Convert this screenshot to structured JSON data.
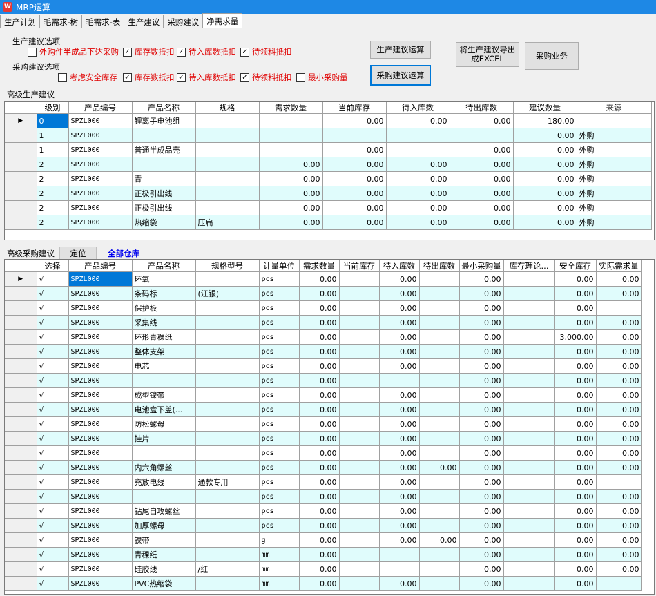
{
  "window": {
    "title": "MRP运算",
    "icon": "app-logo-icon"
  },
  "tabs": [
    "生产计划",
    "毛需求-树",
    "毛需求-表",
    "生产建议",
    "采购建议",
    "净需求量"
  ],
  "active_tab": "净需求量",
  "prod_options": {
    "label": "生产建议选项",
    "items": [
      {
        "label": "外购件半成品下达采购",
        "checked": false
      },
      {
        "label": "库存数抵扣",
        "checked": true
      },
      {
        "label": "待入库数抵扣",
        "checked": true
      },
      {
        "label": "待领料抵扣",
        "checked": true
      }
    ]
  },
  "purch_options": {
    "label": "采购建议选项",
    "items": [
      {
        "label": "考虑安全库存",
        "checked": false
      },
      {
        "label": "库存数抵扣",
        "checked": true
      },
      {
        "label": "待入库数抵扣",
        "checked": true
      },
      {
        "label": "待领料抵扣",
        "checked": true
      },
      {
        "label": "最小采购量",
        "checked": false
      }
    ]
  },
  "buttons": {
    "prod_calc": "生产建议运算",
    "purch_calc": "采购建议运算",
    "export": "将生产建议导出成EXCEL",
    "purch_business": "采购业务"
  },
  "prod_section": {
    "label": "高级生产建议",
    "columns": [
      "级别",
      "产品编号",
      "产品名称",
      "规格",
      "需求数量",
      "当前库存",
      "待入库数",
      "待出库数",
      "建议数量",
      "来源"
    ],
    "rows": [
      [
        "0",
        "SPZL000",
        "锂离子电池组",
        "",
        "",
        "0.00",
        "0.00",
        "0.00",
        "180.00",
        ""
      ],
      [
        "1",
        "SPZL000",
        "",
        "",
        "",
        "",
        "",
        "",
        "0.00",
        "外购"
      ],
      [
        "1",
        "SPZL000",
        "普通半成品壳",
        "",
        "",
        "0.00",
        "",
        "0.00",
        "0.00",
        "外购"
      ],
      [
        "2",
        "SPZL000",
        "",
        "",
        "0.00",
        "0.00",
        "0.00",
        "0.00",
        "0.00",
        "外购"
      ],
      [
        "2",
        "SPZL000",
        "青",
        "",
        "0.00",
        "0.00",
        "0.00",
        "0.00",
        "0.00",
        "外购"
      ],
      [
        "2",
        "SPZL000",
        "正极引出线",
        "",
        "0.00",
        "0.00",
        "0.00",
        "0.00",
        "0.00",
        "外购"
      ],
      [
        "2",
        "SPZL000",
        "正极引出线",
        "",
        "0.00",
        "0.00",
        "0.00",
        "0.00",
        "0.00",
        "外购"
      ],
      [
        "2",
        "SPZL000",
        "热缩袋",
        "压扁",
        "0.00",
        "0.00",
        "0.00",
        "0.00",
        "0.00",
        "外购"
      ]
    ]
  },
  "purch_section": {
    "label": "高级采购建议",
    "locate": "定位",
    "warehouse": "全部仓库",
    "columns": [
      "选择",
      "产品编号",
      "产品名称",
      "规格型号",
      "计量单位",
      "需求数量",
      "当前库存",
      "待入库数",
      "待出库数",
      "最小采购量",
      "库存理论...",
      "安全库存",
      "实际需求量"
    ],
    "rows": [
      [
        "√",
        "SPZL000",
        "环氧",
        "",
        "pcs",
        "0.00",
        "",
        "0.00",
        "",
        "0.00",
        "",
        "0.00",
        "0.00"
      ],
      [
        "√",
        "SPZL000",
        "条码标",
        "(江银)",
        "pcs",
        "0.00",
        "",
        "0.00",
        "",
        "0.00",
        "",
        "0.00",
        "0.00"
      ],
      [
        "√",
        "SPZL000",
        "保护板",
        "",
        "pcs",
        "0.00",
        "",
        "0.00",
        "",
        "0.00",
        "",
        "0.00",
        ""
      ],
      [
        "√",
        "SPZL000",
        "采集线",
        "",
        "pcs",
        "0.00",
        "",
        "0.00",
        "",
        "0.00",
        "",
        "0.00",
        "0.00"
      ],
      [
        "√",
        "SPZL000",
        "环形青稞纸",
        "",
        "pcs",
        "0.00",
        "",
        "0.00",
        "",
        "0.00",
        "",
        "3,000.00",
        "0.00"
      ],
      [
        "√",
        "SPZL000",
        "整体支架",
        "",
        "pcs",
        "0.00",
        "",
        "0.00",
        "",
        "0.00",
        "",
        "0.00",
        "0.00"
      ],
      [
        "√",
        "SPZL000",
        "电芯",
        "",
        "pcs",
        "0.00",
        "",
        "0.00",
        "",
        "0.00",
        "",
        "0.00",
        "0.00"
      ],
      [
        "√",
        "SPZL000",
        "",
        "",
        "pcs",
        "0.00",
        "",
        "",
        "",
        "0.00",
        "",
        "0.00",
        "0.00"
      ],
      [
        "√",
        "SPZL000",
        "成型镍带",
        "",
        "pcs",
        "0.00",
        "",
        "0.00",
        "",
        "0.00",
        "",
        "0.00",
        "0.00"
      ],
      [
        "√",
        "SPZL000",
        "电池盒下盖(...",
        "",
        "pcs",
        "0.00",
        "",
        "0.00",
        "",
        "0.00",
        "",
        "0.00",
        "0.00"
      ],
      [
        "√",
        "SPZL000",
        "防松螺母",
        "",
        "pcs",
        "0.00",
        "",
        "0.00",
        "",
        "0.00",
        "",
        "0.00",
        "0.00"
      ],
      [
        "√",
        "SPZL000",
        "挂片",
        "",
        "pcs",
        "0.00",
        "",
        "0.00",
        "",
        "0.00",
        "",
        "0.00",
        "0.00"
      ],
      [
        "√",
        "SPZL000",
        "",
        "",
        "pcs",
        "0.00",
        "",
        "0.00",
        "",
        "0.00",
        "",
        "0.00",
        "0.00"
      ],
      [
        "√",
        "SPZL000",
        "内六角螺丝",
        "",
        "pcs",
        "0.00",
        "",
        "0.00",
        "0.00",
        "0.00",
        "",
        "0.00",
        "0.00"
      ],
      [
        "√",
        "SPZL000",
        "充放电线",
        "通款专用",
        "pcs",
        "0.00",
        "",
        "0.00",
        "",
        "0.00",
        "",
        "0.00",
        ""
      ],
      [
        "√",
        "SPZL000",
        "",
        "",
        "pcs",
        "0.00",
        "",
        "0.00",
        "",
        "0.00",
        "",
        "0.00",
        "0.00"
      ],
      [
        "√",
        "SPZL000",
        "钻尾自攻螺丝",
        "",
        "pcs",
        "0.00",
        "",
        "0.00",
        "",
        "0.00",
        "",
        "0.00",
        "0.00"
      ],
      [
        "√",
        "SPZL000",
        "加厚螺母",
        "",
        "pcs",
        "0.00",
        "",
        "0.00",
        "",
        "0.00",
        "",
        "0.00",
        "0.00"
      ],
      [
        "√",
        "SPZL000",
        "镍带",
        "",
        "g",
        "0.00",
        "",
        "0.00",
        "0.00",
        "0.00",
        "",
        "0.00",
        "0.00"
      ],
      [
        "√",
        "SPZL000",
        "青稞纸",
        "",
        "mm",
        "0.00",
        "",
        "",
        "",
        "0.00",
        "",
        "0.00",
        "0.00"
      ],
      [
        "√",
        "SPZL000",
        "硅胶线",
        "/红",
        "mm",
        "0.00",
        "",
        "",
        "",
        "0.00",
        "",
        "0.00",
        "0.00"
      ],
      [
        "√",
        "SPZL000",
        "PVC热缩袋",
        "",
        "mm",
        "0.00",
        "",
        "0.00",
        "",
        "0.00",
        "",
        "0.00",
        ""
      ]
    ]
  }
}
